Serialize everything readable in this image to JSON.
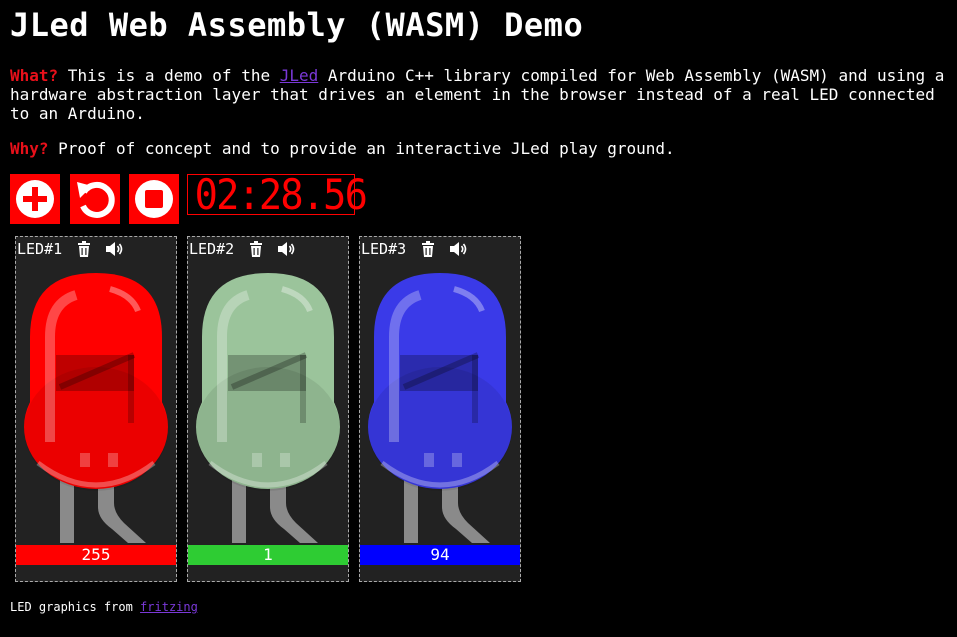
{
  "title": "JLed Web Assembly (WASM) Demo",
  "intro": {
    "what_key": "What?",
    "what_pre": " This is a demo of the ",
    "what_link": "JLed",
    "what_post": " Arduino C++ library compiled for Web Assembly (WASM) and using a hardware abstraction layer that drives an element in the browser instead of a real LED connected to an Arduino.",
    "why_key": "Why?",
    "why_text": " Proof of concept and to provide an interactive JLed play ground."
  },
  "controls": {
    "add_icon": "plus-circle-icon",
    "reset_icon": "undo-icon",
    "stop_icon": "stop-icon",
    "clock": "02:28.56",
    "accent": "#ff0000"
  },
  "leds": [
    {
      "label": "LED#1",
      "value": "255",
      "color": "#ff0000",
      "bar_color": "#ff0000"
    },
    {
      "label": "LED#2",
      "value": "1",
      "color": "#9bc49b",
      "bar_color": "#2ecc33"
    },
    {
      "label": "LED#3",
      "value": "94",
      "color": "#3a3ae8",
      "bar_color": "#0000ff"
    }
  ],
  "footer": {
    "text": "LED graphics from ",
    "link": "fritzing"
  }
}
